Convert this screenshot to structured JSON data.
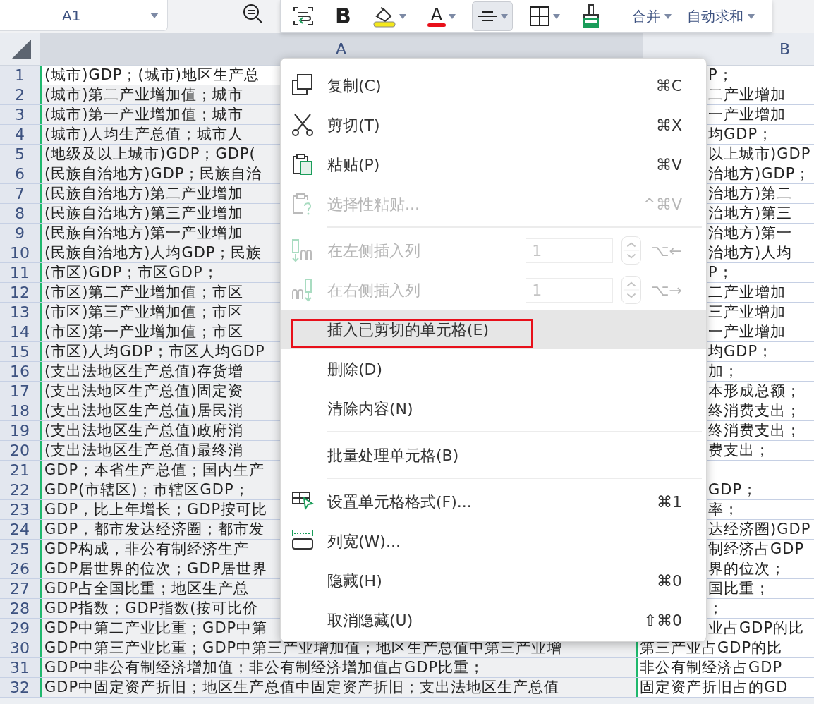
{
  "name_box": {
    "value": "A1"
  },
  "toolbar": {
    "buttons": [
      {
        "kind": "wrap",
        "selected": false
      },
      {
        "kind": "bold",
        "label": "B",
        "selected": false
      },
      {
        "kind": "fill",
        "selected": false,
        "dropdown": true
      },
      {
        "kind": "font_color",
        "label": "A",
        "selected": false,
        "dropdown": true
      },
      {
        "kind": "align",
        "selected": true,
        "dropdown": true
      },
      {
        "kind": "borders",
        "selected": false,
        "dropdown": true
      },
      {
        "kind": "painter",
        "selected": false
      }
    ],
    "menus": [
      {
        "label": "合并"
      },
      {
        "label": "自动求和"
      }
    ]
  },
  "columns": [
    {
      "label": "A",
      "selected": true
    },
    {
      "label": "B",
      "selected": false
    }
  ],
  "rows": [
    {
      "number": "1",
      "active": true,
      "cells": [
        "(城市)GDP；(城市)地区生产总",
        "P；"
      ]
    },
    {
      "number": "2",
      "active": false,
      "cells": [
        "(城市)第二产业增加值；城市",
        "二产业增加"
      ]
    },
    {
      "number": "3",
      "active": false,
      "cells": [
        "(城市)第一产业增加值；城市",
        "一产业增加"
      ]
    },
    {
      "number": "4",
      "active": false,
      "cells": [
        "(城市)人均生产总值；城市人",
        "均GDP；"
      ]
    },
    {
      "number": "5",
      "active": false,
      "cells": [
        "(地级及以上城市)GDP；GDP(",
        "以上城市)GDP"
      ]
    },
    {
      "number": "6",
      "active": false,
      "cells": [
        "(民族自治地方)GDP；民族自治",
        "治地方)GDP；"
      ]
    },
    {
      "number": "7",
      "active": false,
      "cells": [
        "(民族自治地方)第二产业增加",
        "治地方)第二"
      ]
    },
    {
      "number": "8",
      "active": false,
      "cells": [
        "(民族自治地方)第三产业增加",
        "治地方)第三"
      ]
    },
    {
      "number": "9",
      "active": false,
      "cells": [
        "(民族自治地方)第一产业增加",
        "治地方)第一"
      ]
    },
    {
      "number": "10",
      "active": false,
      "cells": [
        "(民族自治地方)人均GDP；民族",
        "治地方)人均"
      ]
    },
    {
      "number": "11",
      "active": false,
      "cells": [
        "(市区)GDP；市区GDP；",
        "P；"
      ]
    },
    {
      "number": "12",
      "active": false,
      "cells": [
        "(市区)第二产业增加值；市区",
        "二产业增加"
      ]
    },
    {
      "number": "13",
      "active": false,
      "cells": [
        "(市区)第三产业增加值；市区",
        "三产业增加"
      ]
    },
    {
      "number": "14",
      "active": false,
      "cells": [
        "(市区)第一产业增加值；市区",
        "一产业增加"
      ]
    },
    {
      "number": "15",
      "active": false,
      "cells": [
        "(市区)人均GDP；市区人均GDP",
        "均GDP；"
      ]
    },
    {
      "number": "16",
      "active": false,
      "cells": [
        "(支出法地区生产总值)存货增",
        "加；"
      ]
    },
    {
      "number": "17",
      "active": false,
      "cells": [
        "(支出法地区生产总值)固定资",
        "本形成总额；"
      ]
    },
    {
      "number": "18",
      "active": false,
      "cells": [
        "(支出法地区生产总值)居民消",
        "终消费支出；"
      ]
    },
    {
      "number": "19",
      "active": false,
      "cells": [
        "(支出法地区生产总值)政府消",
        "终消费支出；"
      ]
    },
    {
      "number": "20",
      "active": false,
      "cells": [
        "(支出法地区生产总值)最终消",
        "费支出；"
      ]
    },
    {
      "number": "21",
      "active": false,
      "cells": [
        "GDP；本省生产总值；国内生产"
      ]
    },
    {
      "number": "22",
      "active": false,
      "cells": [
        "GDP(市辖区)；市辖区GDP；",
        "GDP；"
      ]
    },
    {
      "number": "23",
      "active": false,
      "cells": [
        "GDP，比上年增长；GDP按可比",
        "率；"
      ]
    },
    {
      "number": "24",
      "active": false,
      "cells": [
        "GDP，都市发达经济圈；都市发",
        "达经济圈)GDP"
      ]
    },
    {
      "number": "25",
      "active": false,
      "cells": [
        "GDP构成，非公有制经济生产",
        "制经济占GDP"
      ]
    },
    {
      "number": "26",
      "active": false,
      "cells": [
        "GDP居世界的位次；GDP居世界",
        "界的位次；"
      ]
    },
    {
      "number": "27",
      "active": false,
      "cells": [
        "GDP占全国比重；地区生产总",
        "国比重；"
      ]
    },
    {
      "number": "28",
      "active": false,
      "cells": [
        "GDP指数；GDP指数(按可比价",
        "；"
      ]
    },
    {
      "number": "29",
      "active": false,
      "cells": [
        "GDP中第二产业比重；GDP中第",
        "业占GDP的比"
      ]
    },
    {
      "number": "30",
      "active": false,
      "cells": [
        "GDP中第三产业比重；GDP中第三产业增加值；地区生产总值中第三产业增",
        "第三产业占GDP的比"
      ]
    },
    {
      "number": "31",
      "active": false,
      "cells": [
        "GDP中非公有制经济增加值；非公有制经济增加值占GDP比重；",
        "非公有制经济占GDP"
      ]
    },
    {
      "number": "32",
      "active": false,
      "cells": [
        "GDP中固定资产折旧；地区生产总值中固定资产折旧；支出法地区生产总值",
        "固定资产折旧占的GD"
      ]
    }
  ],
  "context_menu": {
    "items": [
      {
        "kind": "item",
        "label": "复制(C)",
        "shortcut": "⌘C",
        "disabled": false,
        "selected": false,
        "outlined": false
      },
      {
        "kind": "item",
        "label": "剪切(T)",
        "shortcut": "⌘X",
        "disabled": false,
        "selected": false,
        "outlined": false
      },
      {
        "kind": "item",
        "label": "粘贴(P)",
        "shortcut": "⌘V",
        "disabled": false,
        "selected": false,
        "outlined": false
      },
      {
        "kind": "item",
        "label": "选择性粘贴...",
        "shortcut": "^⌘V",
        "disabled": true,
        "selected": false,
        "outlined": false
      },
      {
        "kind": "separator"
      },
      {
        "kind": "spinner",
        "label": "在左侧插入列",
        "value": "1",
        "shortcut": "⌥←",
        "disabled": true,
        "selected": false,
        "outlined": false
      },
      {
        "kind": "spinner",
        "label": "在右侧插入列",
        "value": "1",
        "shortcut": "⌥→",
        "disabled": true,
        "selected": false,
        "outlined": false
      },
      {
        "kind": "item",
        "label": "插入已剪切的单元格(E)",
        "disabled": false,
        "selected": true,
        "outlined": true
      },
      {
        "kind": "item",
        "label": "删除(D)",
        "disabled": false,
        "selected": false,
        "outlined": false
      },
      {
        "kind": "item",
        "label": "清除内容(N)",
        "disabled": false,
        "selected": false,
        "outlined": false
      },
      {
        "kind": "separator"
      },
      {
        "kind": "item",
        "label": "批量处理单元格(B)",
        "disabled": false,
        "selected": false,
        "outlined": false
      },
      {
        "kind": "separator"
      },
      {
        "kind": "item",
        "label": "设置单元格格式(F)...",
        "shortcut": "⌘1",
        "disabled": false,
        "selected": false,
        "outlined": false
      },
      {
        "kind": "item",
        "label": "列宽(W)...",
        "disabled": false,
        "selected": false,
        "outlined": false
      },
      {
        "kind": "item",
        "label": "隐藏(H)",
        "shortcut": "⌘0",
        "disabled": false,
        "selected": false,
        "outlined": false
      },
      {
        "kind": "item",
        "label": "取消隐藏(U)",
        "shortcut": "⇧⌘0",
        "disabled": false,
        "selected": false,
        "outlined": false
      }
    ]
  }
}
